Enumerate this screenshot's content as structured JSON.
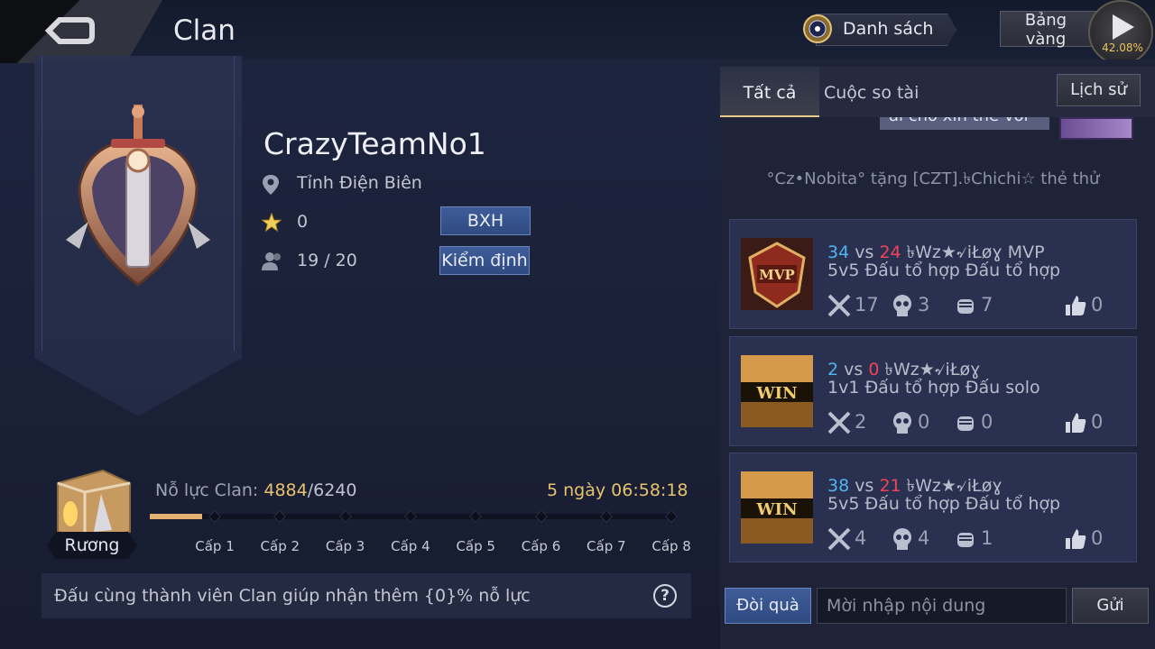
{
  "header": {
    "title": "Clan",
    "list_label": "Danh sách",
    "gold_board_line1": "Bảng",
    "gold_board_line2": "vàng",
    "progress_pct": "42.08%"
  },
  "clan": {
    "name": "CrazyTeamNo1",
    "location": "Tỉnh Điện Biên",
    "stars": "0",
    "members": "19 / 20",
    "rank_button": "BXH",
    "verify_button": "Kiểm định"
  },
  "effort": {
    "chest_label": "Rương",
    "label": "Nỗ lực Clan:",
    "current": "4884",
    "separator": "/",
    "max": "6240",
    "timer": "5 ngày 06:58:18",
    "progress_fraction": 0.1,
    "levels": [
      "Cấp 1",
      "Cấp 2",
      "Cấp 3",
      "Cấp 4",
      "Cấp 5",
      "Cấp 6",
      "Cấp 7",
      "Cấp 8"
    ]
  },
  "tip": {
    "text": "Đấu cùng thành viên Clan giúp nhận thêm {0}% nỗ lực",
    "help_icon": "?"
  },
  "chat": {
    "tabs": [
      "Tất cả",
      "Cuộc so tài"
    ],
    "history_button": "Lịch sử",
    "cut_message": "ai cho xin thẻ với",
    "gift_message": "°Cz•Nobita° tặng [CZT].৳Chichi☆ thẻ thử",
    "matches": [
      {
        "badge": "MVP",
        "score_a": "34",
        "vs": "vs",
        "score_b": "24",
        "player": "৳Wz★৵iŁøɣ MVP",
        "mode": "5v5 Đấu tổ hợp Đấu tổ hợp",
        "kills": "17",
        "deaths": "3",
        "assists": "7",
        "likes": "0"
      },
      {
        "badge": "WIN",
        "score_a": "2",
        "vs": "vs",
        "score_b": "0",
        "player": "৳Wz★৵iŁøɣ",
        "mode": "1v1 Đấu tổ hợp Đấu solo",
        "kills": "2",
        "deaths": "0",
        "assists": "0",
        "likes": "0"
      },
      {
        "badge": "WIN",
        "score_a": "38",
        "vs": "vs",
        "score_b": "21",
        "player": "৳Wz★৵iŁøɣ",
        "mode": "5v5 Đấu tổ hợp Đấu tổ hợp",
        "kills": "4",
        "deaths": "4",
        "assists": "1",
        "likes": "0"
      }
    ],
    "gift_button": "Đòi quà",
    "input_placeholder": "Mời nhập nội dung",
    "send_button": "Gửi"
  },
  "colors": {
    "accent_gold": "#e6c36d",
    "score_blue": "#4fb4f0",
    "score_red": "#f0445a",
    "button_blue": "#3f5d9a"
  },
  "icons": [
    "back-arrow-icon",
    "medal-icon",
    "play-icon",
    "location-pin-icon",
    "star-icon",
    "members-icon",
    "chest-icon",
    "help-icon",
    "swords-icon",
    "skull-icon",
    "fist-icon",
    "thumbs-up-icon"
  ]
}
